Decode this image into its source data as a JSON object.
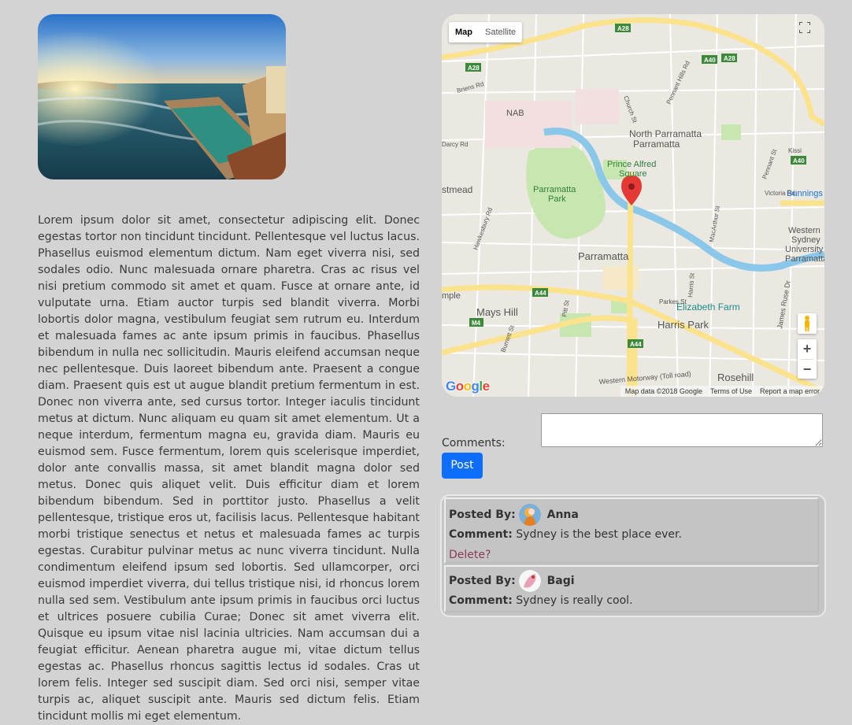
{
  "hero_image": {
    "alt": "hero-photo"
  },
  "article": {
    "text": "Lorem ipsum dolor sit amet, consectetur adipiscing elit. Donec egestas tortor non tincidunt tincidunt. Pellentesque vel luctus lacus. Phasellus euismod elementum dictum. Nam eget viverra nisi, sed sodales odio. Nunc malesuada ornare pharetra. Cras ac risus vel nisi pretium commodo sit amet et quam. Fusce at ornare ante, id vulputate urna. Etiam auctor turpis sed blandit viverra. Morbi lobortis dolor magna, vestibulum feugiat sem rutrum eu. Interdum et malesuada fames ac ante ipsum primis in faucibus. Phasellus bibendum in nulla nec sollicitudin. Mauris eleifend accumsan neque nec pellentesque. Duis laoreet bibendum ante. Praesent a congue diam. Praesent quis est ut augue blandit pretium fermentum in est. Donec non viverra ante, sed cursus tortor. Integer iaculis tincidunt metus at dictum. Nunc aliquam eu quam sit amet elementum. Ut a neque interdum, fermentum magna eu, gravida diam. Mauris eu euismod sem. Fusce fermentum, lorem quis scelerisque imperdiet, dolor ante convallis massa, sit amet blandit magna dolor sed metus. Donec quis aliquet velit. Duis efficitur diam et lorem bibendum bibendum. Sed in porttitor justo. Phasellus a velit pellentesque, tristique eros ut, facilisis lacus. Pellentesque habitant morbi tristique senectus et netus et malesuada fames ac turpis egestas. Curabitur pulvinar metus ac nunc viverra tincidunt. Nulla condimentum eleifend ipsum sed lobortis. Sed ullamcorper, orci euismod imperdiet viverra, dui tellus tristique nisi, id rhoncus lorem nulla sed sem. Vestibulum ante ipsum primis in faucibus orci luctus et ultrices posuere cubilia Curae; Donec sit amet viverra elit. Quisque eu ipsum vitae nisl lacinia ultricies. Nam accumsan dui a feugiat efficitur. Aenean pharetra augue mi, vitae dictum tellus egestas ac. Phasellus rhoncus sagittis lectus id sodales. Cras ut lorem felis. Integer sed suscipit diam. Sed orci nisi, semper vitae turpis ac, aliquet suscipit ante. Mauris sed dictum felis. Etiam tincidunt mollis mi eget elementum."
  },
  "map": {
    "type_buttons": {
      "map": "Map",
      "satellite": "Satellite"
    },
    "labels": {
      "north_parramatta": "North Parramatta",
      "north_parramatta_2": "Parramatta",
      "prince_alfred_1": "Prince Alfred",
      "prince_alfred_2": "Square",
      "parramatta_park_1": "Parramatta",
      "parramatta_park_2": "Park",
      "parramatta": "Parramatta",
      "mays_hill": "Mays Hill",
      "harris_park": "Harris Park",
      "rosehill": "Rosehill",
      "elizabeth_farm": "Elizabeth Farm",
      "western_sydney_1": "Western",
      "western_sydney_2": "Sydney",
      "western_sydney_3": "University",
      "western_sydney_4": "Parramatta",
      "bunnings": "Bunnings",
      "nab": "NAB",
      "stmead": "stmead",
      "mple": "mple",
      "darcy_rd": "Darcy Rd",
      "briens_rd": "Briens Rd",
      "church_st": "Church St",
      "pennant_hills_rd": "Pennant Hills Rd",
      "victoria_rd": "Victoria Rd",
      "pennant_st": "Pennant St",
      "kissing": "Kissi",
      "macarthur_st": "MacArthur St",
      "james_ruse_dr": "James Ruse Dr",
      "harris_st": "Harris St",
      "parkes_st": "Parkes St",
      "pitt_st": "Pitt St",
      "burnett_st": "Burnett St",
      "hawkesbury_rd": "Hawkesbury Rd",
      "western_motorway": "Western Motorway (Toll road)",
      "a28_1": "A28",
      "a28_2": "A28",
      "a28_3": "A28",
      "a40_1": "A40",
      "a40_2": "A40",
      "a44_1": "A44",
      "a44_2": "A44",
      "m4": "M4"
    },
    "google_logo": "Google",
    "footer": {
      "map_data": "Map data ©2018 Google",
      "terms": "Terms of Use",
      "report": "Report a map error"
    },
    "zoom_in": "+",
    "zoom_out": "−",
    "colors": {
      "park": "#c8e6b0",
      "road_major": "#fbe38e",
      "water": "#8bc7e8",
      "marker": "#e53935"
    }
  },
  "comment_form": {
    "label": "Comments:",
    "textarea_value": "",
    "post_button": "Post"
  },
  "comments": [
    {
      "posted_by_label": "Posted By:",
      "author": "Anna",
      "comment_label": "Comment:",
      "text": "Sydney is the best place ever.",
      "delete_label": "Delete?"
    },
    {
      "posted_by_label": "Posted By:",
      "author": "Bagi",
      "comment_label": "Comment:",
      "text": "Sydney is really cool."
    }
  ]
}
